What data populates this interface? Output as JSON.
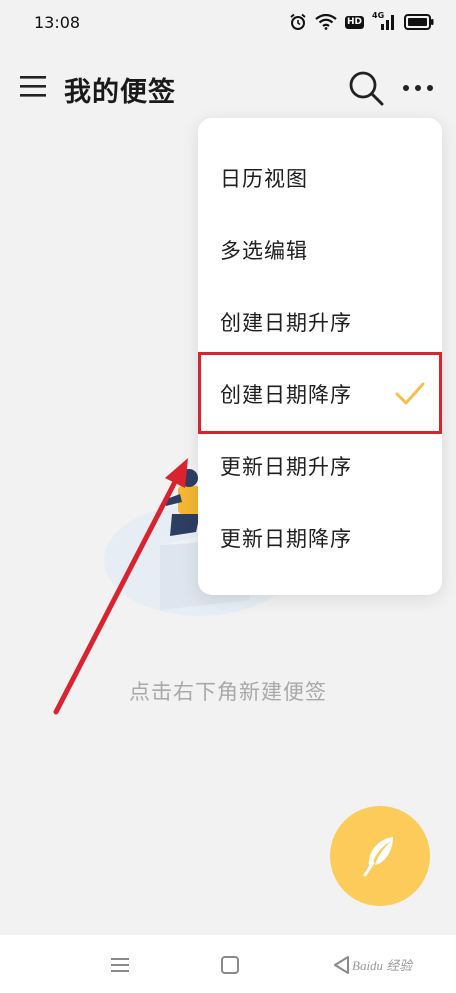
{
  "status_bar": {
    "time": "13:08",
    "hd": "HD",
    "network": "4G",
    "icons": [
      "alarm-icon",
      "wifi-icon",
      "hd-icon",
      "signal-icon",
      "battery-icon"
    ]
  },
  "toolbar": {
    "title": "我的便签",
    "icons": [
      "menu-icon",
      "search-icon",
      "more-icon"
    ]
  },
  "dropdown": {
    "items": [
      {
        "label": "日历视图",
        "selected": false
      },
      {
        "label": "多选编辑",
        "selected": false
      },
      {
        "label": "创建日期升序",
        "selected": false
      },
      {
        "label": "创建日期降序",
        "selected": true
      },
      {
        "label": "更新日期升序",
        "selected": false
      },
      {
        "label": "更新日期降序",
        "selected": false
      }
    ],
    "check_color": "#f5c048"
  },
  "empty_state": {
    "hint": "点击右下角新建便签"
  },
  "fab": {
    "icon": "feather-icon",
    "color": "#fccb5a"
  },
  "annotation": {
    "highlight_color": "#d9232e",
    "highlighted_item": "创建日期降序"
  },
  "nav_bar": {
    "icons": [
      "recents-icon",
      "home-icon",
      "back-icon"
    ]
  },
  "watermark": "Baidu 经验"
}
